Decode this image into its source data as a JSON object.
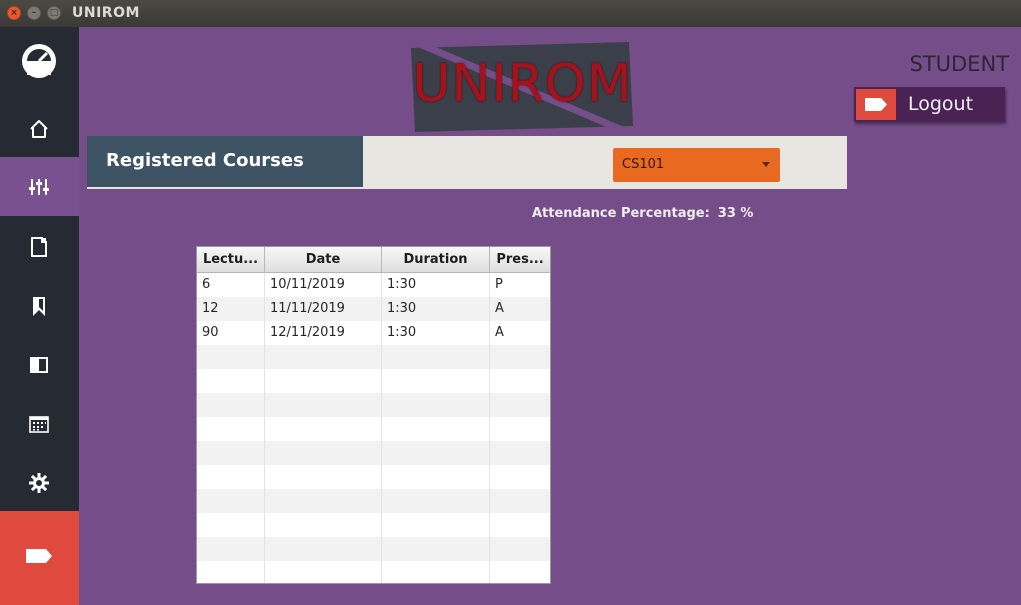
{
  "window": {
    "title": "UNIROM"
  },
  "sidebar": {
    "items": [
      {
        "name": "home",
        "icon": "home-icon"
      },
      {
        "name": "registered-courses",
        "icon": "sliders-icon",
        "active": true
      },
      {
        "name": "documents",
        "icon": "document-icon"
      },
      {
        "name": "bookmarks",
        "icon": "bookmark-icon"
      },
      {
        "name": "panel",
        "icon": "half-square-icon"
      },
      {
        "name": "calendar",
        "icon": "calendar-icon"
      },
      {
        "name": "settings",
        "icon": "gear-icon"
      },
      {
        "name": "exit",
        "icon": "tag-icon"
      }
    ]
  },
  "logo": {
    "text": "UNIROM"
  },
  "user": {
    "role": "STUDENT"
  },
  "logout": {
    "label": "Logout"
  },
  "header": {
    "title": "Registered Courses"
  },
  "course_select": {
    "selected": "CS101"
  },
  "attendance": {
    "label": "Attendance Percentage:",
    "value": "33 %"
  },
  "table": {
    "columns": [
      "Lectu...",
      "Date",
      "Duration",
      "Pres..."
    ],
    "rows": [
      [
        "6",
        "10/11/2019",
        "1:30",
        "P"
      ],
      [
        "12",
        "11/11/2019",
        "1:30",
        "A"
      ],
      [
        "90",
        "12/11/2019",
        "1:30",
        "A"
      ],
      [
        "",
        "",
        "",
        ""
      ],
      [
        "",
        "",
        "",
        ""
      ],
      [
        "",
        "",
        "",
        ""
      ],
      [
        "",
        "",
        "",
        ""
      ],
      [
        "",
        "",
        "",
        ""
      ],
      [
        "",
        "",
        "",
        ""
      ],
      [
        "",
        "",
        "",
        ""
      ],
      [
        "",
        "",
        "",
        ""
      ],
      [
        "",
        "",
        "",
        ""
      ],
      [
        "",
        "",
        "",
        ""
      ]
    ]
  },
  "colors": {
    "background": "#754d88",
    "sidebar": "#262a33",
    "sidebar_active": "#7a5190",
    "accent_red": "#e04a3e",
    "select_orange": "#e8691f",
    "header_title_bg": "#3e5464",
    "logo_red": "#a4131c"
  }
}
